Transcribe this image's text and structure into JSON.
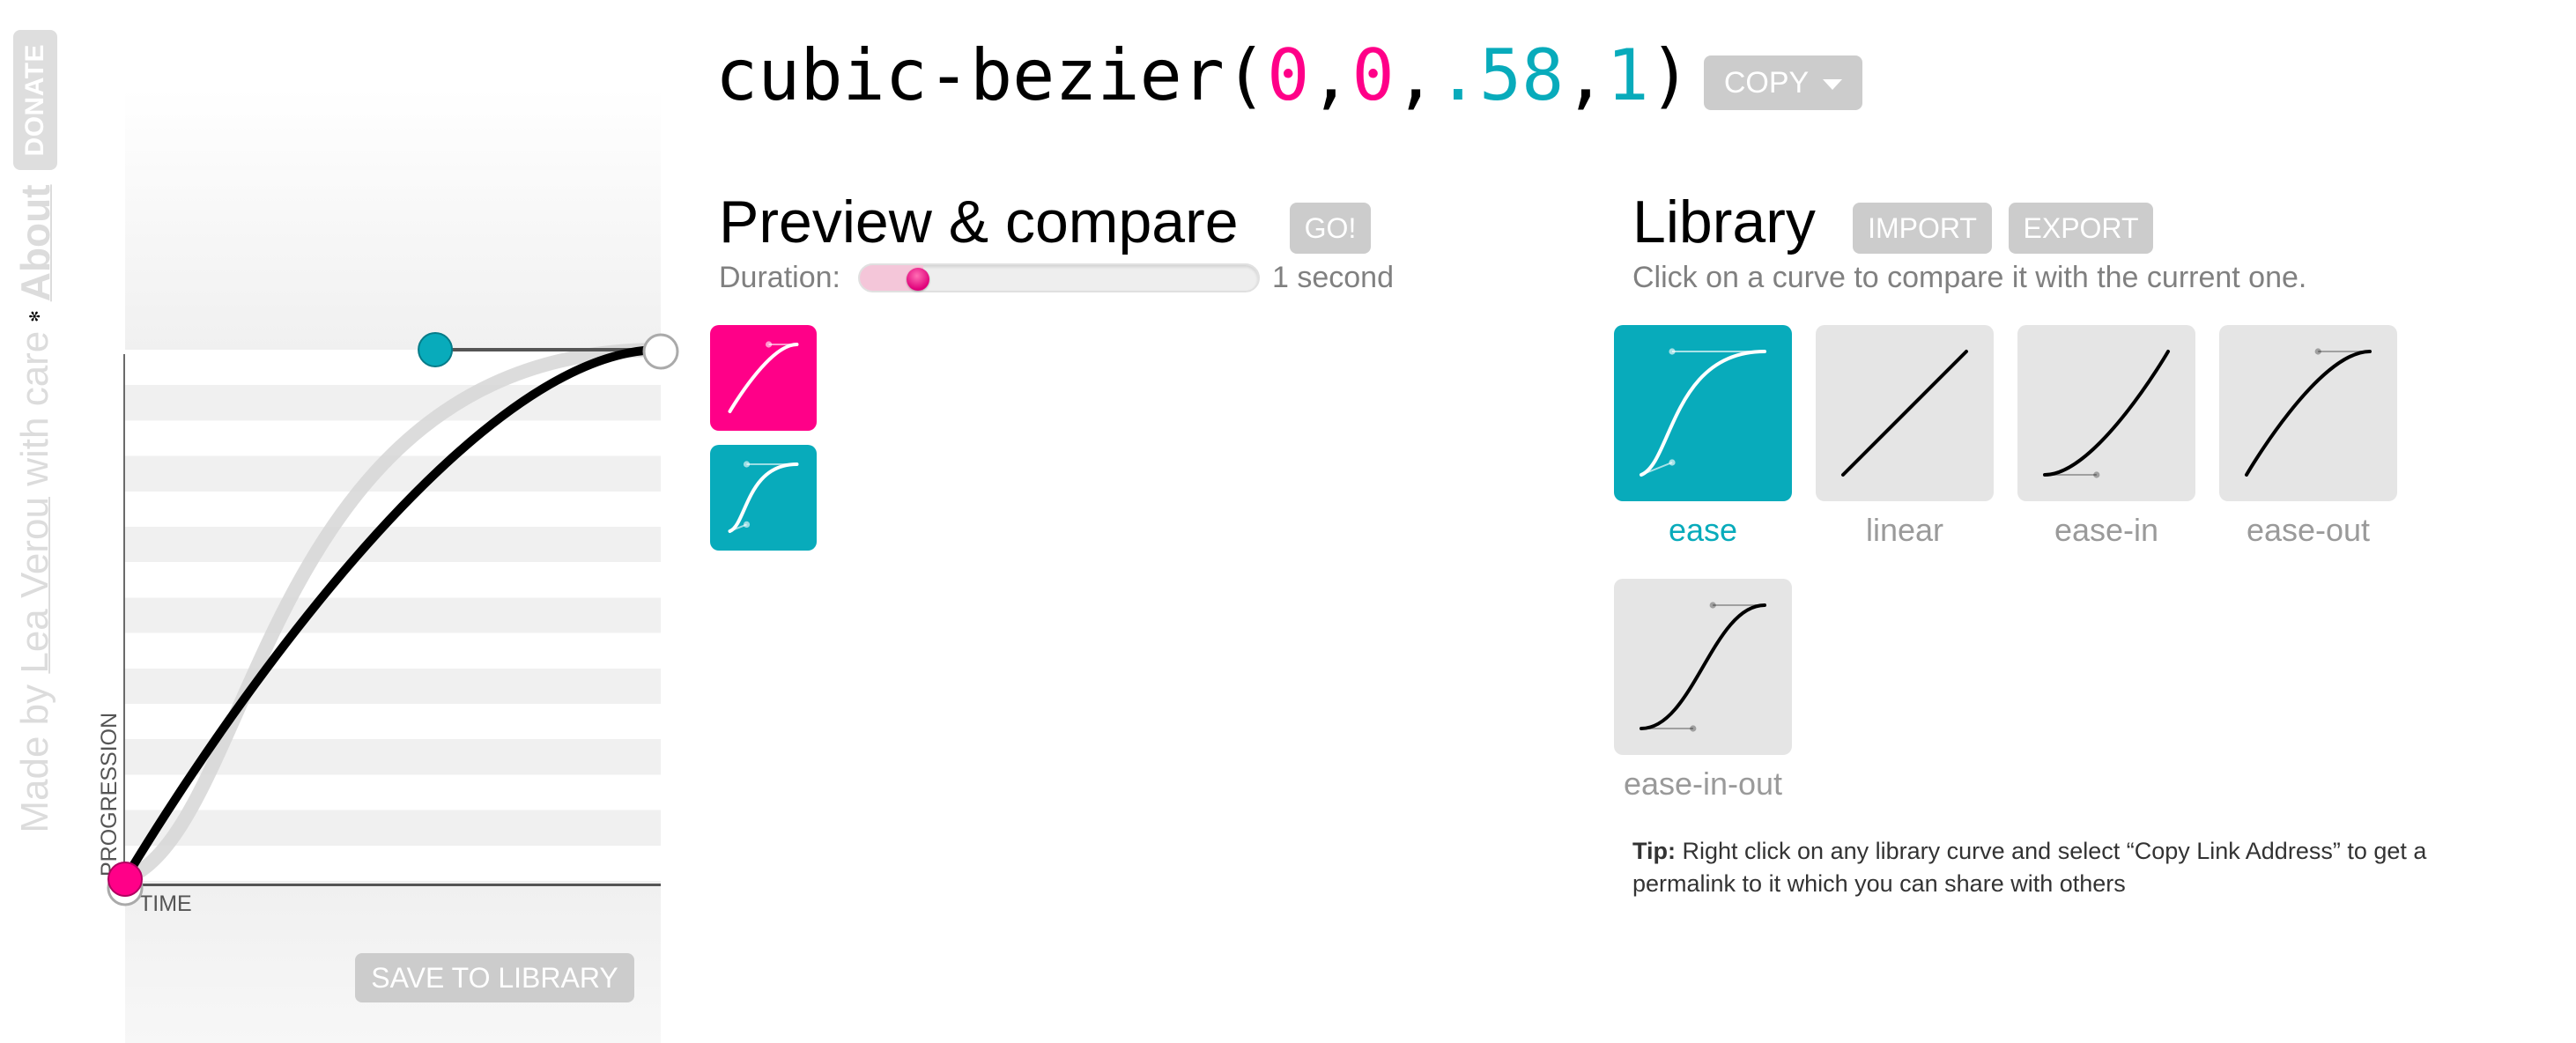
{
  "sidebar": {
    "made_by": "Made by",
    "author": "Lea Verou",
    "with_care": "with care",
    "flower_icon": "✻",
    "about": "About",
    "donate": "DONATE"
  },
  "title": {
    "prefix": "cubic-bezier(",
    "p1x": "0",
    "p1y": "0",
    "p2x": ".58",
    "p2y": "1",
    "comma": ",",
    "suffix": ")",
    "copy_label": "COPY"
  },
  "editor": {
    "current_curve": [
      0,
      0,
      0.58,
      1
    ],
    "comparison_curve": [
      0.25,
      0.1,
      0.25,
      1
    ],
    "axis_x_label": "TIME",
    "axis_y_label": "PROGRESSION",
    "save_label": "SAVE TO LIBRARY"
  },
  "preview": {
    "heading": "Preview & compare",
    "go_label": "GO!",
    "duration_label": "Duration:",
    "duration_value": "1 second",
    "duration_seconds": 1,
    "duration_min": 0.1,
    "duration_max": 10
  },
  "library": {
    "heading": "Library",
    "import_label": "IMPORT",
    "export_label": "EXPORT",
    "hint": "Click on a curve to compare it with the current one.",
    "items": [
      {
        "name": "ease",
        "curve": [
          0.25,
          0.1,
          0.25,
          1
        ],
        "selected": true
      },
      {
        "name": "linear",
        "curve": [
          0,
          0,
          1,
          1
        ],
        "selected": false
      },
      {
        "name": "ease-in",
        "curve": [
          0.42,
          0,
          1,
          1
        ],
        "selected": false
      },
      {
        "name": "ease-out",
        "curve": [
          0,
          0,
          0.58,
          1
        ],
        "selected": false
      },
      {
        "name": "ease-in-out",
        "curve": [
          0.42,
          0,
          0.58,
          1
        ],
        "selected": false
      }
    ],
    "tip_label": "Tip:",
    "tip_text": " Right click on any library curve and select “Copy Link Address” to get a permalink to it which you can share with others"
  },
  "colors": {
    "pink": "#ff0088",
    "teal": "#08abbb",
    "button_gray": "#cccccc"
  }
}
